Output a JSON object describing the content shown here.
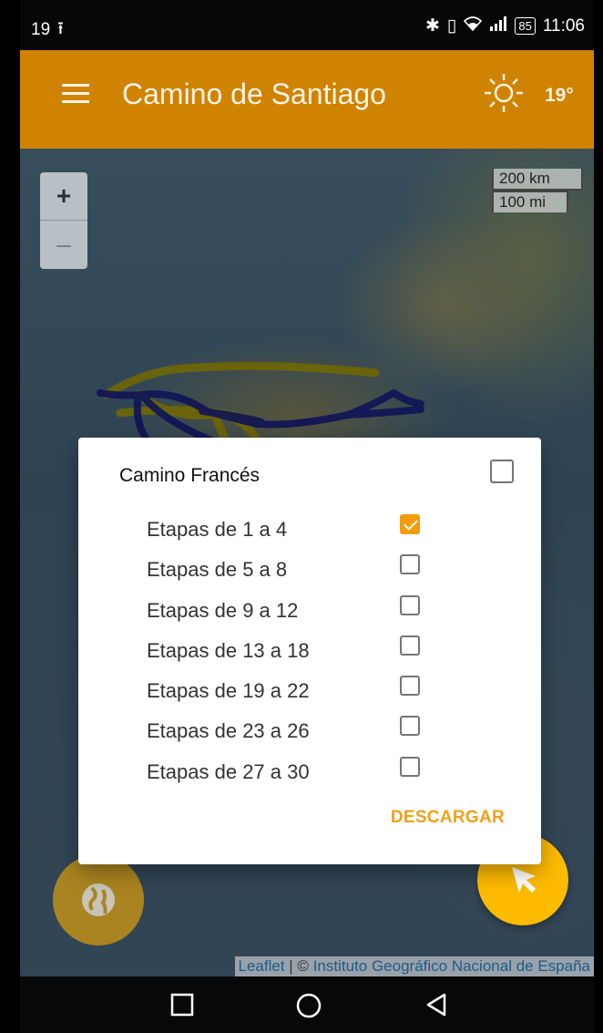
{
  "status_bar": {
    "left_text": "19",
    "upload_glyph": "upload-icon",
    "battery": "85",
    "time": "11:06"
  },
  "app_bar": {
    "title": "Camino de Santiago",
    "weather_icon": "sun-icon",
    "temperature": "19°"
  },
  "map": {
    "zoom_in": "+",
    "zoom_out": "–",
    "scale_km": "200 km",
    "scale_mi": "100 mi",
    "attribution_leaflet": "Leaflet",
    "attribution_sep": " | © ",
    "attribution_ign": "Instituto Geográfico Nacional de España"
  },
  "dialog": {
    "title": "Camino Francés",
    "master_checked": false,
    "stages": [
      {
        "label": "Etapas de 1 a 4",
        "checked": true
      },
      {
        "label": "Etapas de 5 a 8",
        "checked": false
      },
      {
        "label": "Etapas de 9 a 12",
        "checked": false
      },
      {
        "label": "Etapas de 13 a 18",
        "checked": false
      },
      {
        "label": "Etapas de 19 a 22",
        "checked": false
      },
      {
        "label": "Etapas de 23 a 26",
        "checked": false
      },
      {
        "label": "Etapas de 27 a 30",
        "checked": false
      }
    ],
    "download_label": "DESCARGAR"
  },
  "colors": {
    "app_bar": "#d08300",
    "accent": "#f39c0b",
    "fab": "#ffbb00",
    "route_blue": "#1a1f8c",
    "route_yellow": "#b9a800"
  }
}
